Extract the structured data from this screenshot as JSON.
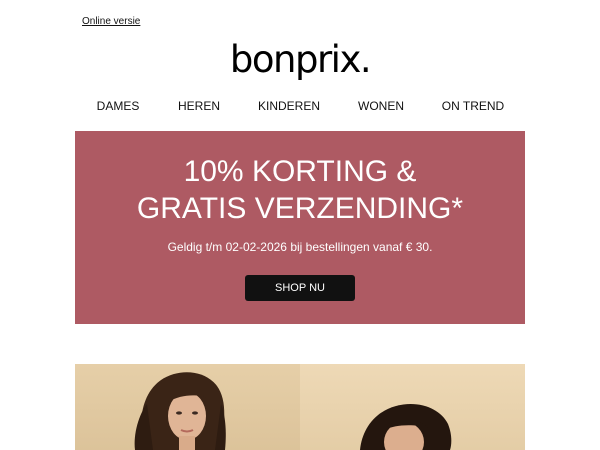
{
  "header": {
    "online_version_link": "Online versie",
    "logo_text": "bonprix."
  },
  "nav": {
    "items": [
      {
        "label": "DAMES"
      },
      {
        "label": "HEREN"
      },
      {
        "label": "KINDEREN"
      },
      {
        "label": "WONEN"
      },
      {
        "label": "ON TREND"
      }
    ]
  },
  "promo": {
    "title_line1": "10% KORTING &",
    "title_line2": "GRATIS VERZENDING*",
    "subtitle": "Geldig t/m 02-02-2026 bij bestellingen vanaf € 30.",
    "button_label": "SHOP NU",
    "background_color": "#ae5a63"
  },
  "colors": {
    "promo_bg": "#ae5a63",
    "button_bg": "#111111",
    "hero_bg": "#e6cfa8"
  }
}
